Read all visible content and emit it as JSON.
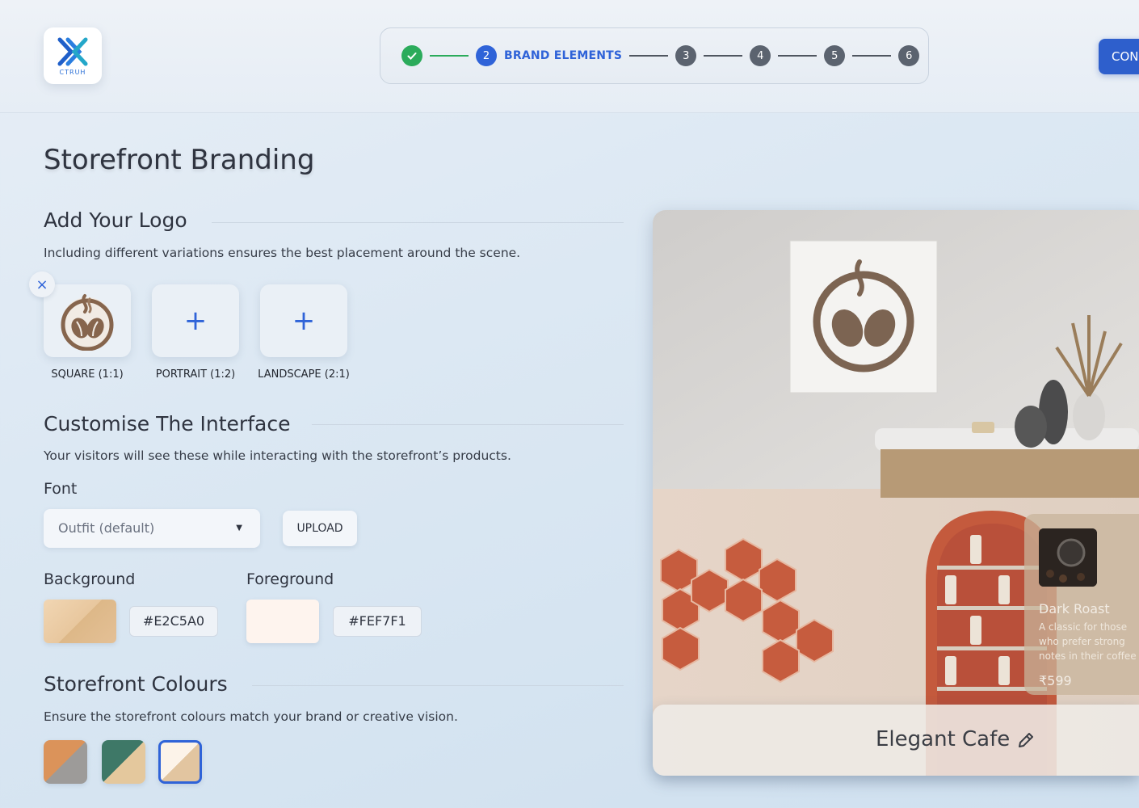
{
  "header": {
    "logo_text": "CTRUH",
    "steps": [
      {
        "number": "",
        "state": "done"
      },
      {
        "number": "2",
        "state": "active",
        "label": "BRAND ELEMENTS"
      },
      {
        "number": "3",
        "state": "todo"
      },
      {
        "number": "4",
        "state": "todo"
      },
      {
        "number": "5",
        "state": "todo"
      },
      {
        "number": "6",
        "state": "todo"
      }
    ],
    "continue_label": "CON"
  },
  "page": {
    "title": "Storefront Branding"
  },
  "logo_section": {
    "title": "Add Your Logo",
    "description": "Including different variations ensures the best placement around the scene.",
    "slots": [
      {
        "label": "SQUARE (1:1)",
        "filled": true
      },
      {
        "label": "PORTRAIT (1:2)",
        "filled": false
      },
      {
        "label": "LANDSCAPE (2:1)",
        "filled": false
      }
    ],
    "add_symbol": "+",
    "remove_symbol": "×"
  },
  "interface_section": {
    "title": "Customise The Interface",
    "description": "Your visitors will see these while interacting with the storefront’s products.",
    "font_label": "Font",
    "font_value": "Outfit (default)",
    "upload_label": "UPLOAD",
    "background_label": "Background",
    "background_hex": "#E2C5A0",
    "foreground_label": "Foreground",
    "foreground_hex": "#FEF7F1"
  },
  "colours_section": {
    "title": "Storefront Colours",
    "description": "Ensure the storefront colours match your brand or creative vision.",
    "themes": [
      {
        "a": "#d9925a",
        "b": "#9c9a98",
        "selected": false
      },
      {
        "a": "#3f7868",
        "b": "#e3c79c",
        "selected": false
      },
      {
        "a": "#fbf1e6",
        "b": "#e2c5a0",
        "selected": true
      }
    ]
  },
  "preview": {
    "product_name": "Dark Roast",
    "product_desc": "A classic for those who prefer strong notes in their coffee",
    "product_price": "₹599",
    "store_name": "Elegant Cafe"
  },
  "colors": {
    "accent": "#2f63d8",
    "success": "#2bab5b",
    "step_todo": "#5b636f"
  }
}
